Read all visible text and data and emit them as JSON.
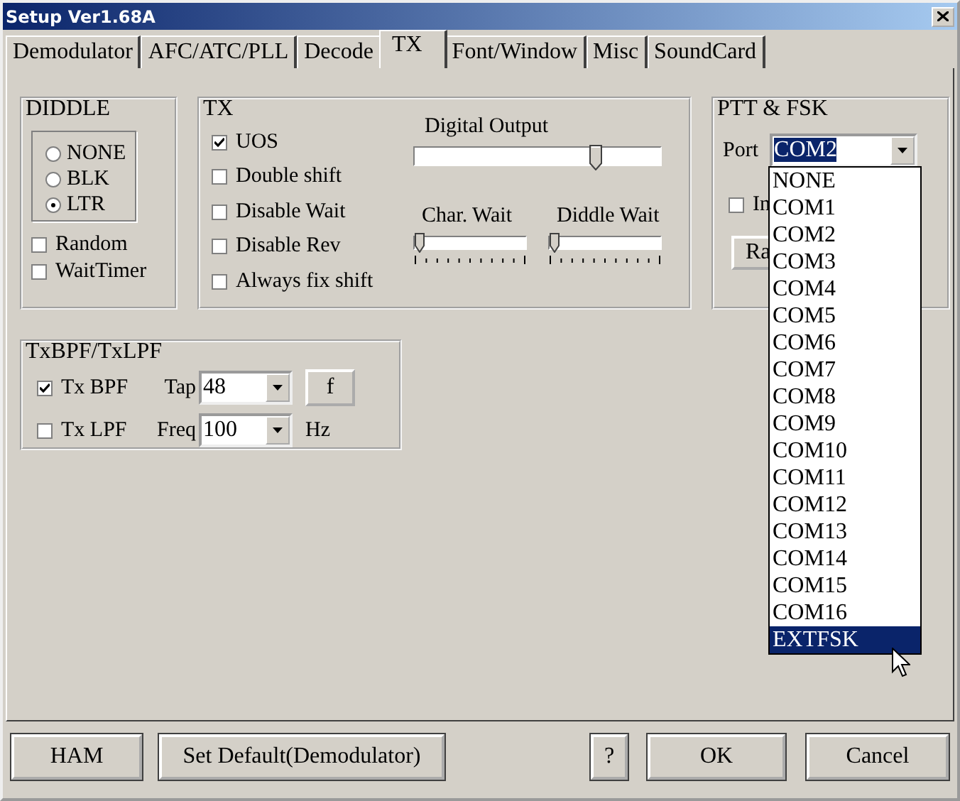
{
  "window": {
    "title": "Setup Ver1.68A"
  },
  "tabs": [
    {
      "label": "Demodulator",
      "selected": false
    },
    {
      "label": "AFC/ATC/PLL",
      "selected": false
    },
    {
      "label": "Decode",
      "selected": false
    },
    {
      "label": "TX",
      "selected": true
    },
    {
      "label": "Font/Window",
      "selected": false
    },
    {
      "label": "Misc",
      "selected": false
    },
    {
      "label": "SoundCard",
      "selected": false
    }
  ],
  "diddle": {
    "title": "DIDDLE",
    "options": [
      {
        "label": "NONE",
        "selected": false
      },
      {
        "label": "BLK",
        "selected": false
      },
      {
        "label": "LTR",
        "selected": true
      }
    ],
    "checkboxes": [
      {
        "label": "Random",
        "checked": false
      },
      {
        "label": "WaitTimer",
        "checked": false
      }
    ]
  },
  "tx": {
    "title": "TX",
    "checkboxes": [
      {
        "label": "UOS",
        "checked": true
      },
      {
        "label": "Double shift",
        "checked": false
      },
      {
        "label": "Disable Wait",
        "checked": false
      },
      {
        "label": "Disable Rev",
        "checked": false
      },
      {
        "label": "Always fix shift",
        "checked": false
      }
    ],
    "sliders": [
      {
        "label": "Digital Output",
        "kind": "plain",
        "level": 0.74
      },
      {
        "label": "Char. Wait",
        "kind": "ticked",
        "level": 0
      },
      {
        "label": "Diddle Wait",
        "kind": "ticked",
        "level": 0
      }
    ]
  },
  "ptt": {
    "title": "PTT & FSK",
    "port_label": "Port",
    "port_value": "COM2",
    "invert": {
      "label": "In",
      "checked": false
    },
    "button": "Ra",
    "options": [
      {
        "label": "NONE",
        "selected": false
      },
      {
        "label": "COM1",
        "selected": false
      },
      {
        "label": "COM2",
        "selected": false
      },
      {
        "label": "COM3",
        "selected": false
      },
      {
        "label": "COM4",
        "selected": false
      },
      {
        "label": "COM5",
        "selected": false
      },
      {
        "label": "COM6",
        "selected": false
      },
      {
        "label": "COM7",
        "selected": false
      },
      {
        "label": "COM8",
        "selected": false
      },
      {
        "label": "COM9",
        "selected": false
      },
      {
        "label": "COM10",
        "selected": false
      },
      {
        "label": "COM11",
        "selected": false
      },
      {
        "label": "COM12",
        "selected": false
      },
      {
        "label": "COM13",
        "selected": false
      },
      {
        "label": "COM14",
        "selected": false
      },
      {
        "label": "COM15",
        "selected": false
      },
      {
        "label": "COM16",
        "selected": false
      },
      {
        "label": "EXTFSK",
        "selected": true
      }
    ]
  },
  "filters": {
    "title": "TxBPF/TxLPF",
    "rows": [
      {
        "label": "Tx BPF",
        "checked": true,
        "field_label": "Tap",
        "value": "48",
        "extra": "f",
        "kind": "button"
      },
      {
        "label": "Tx LPF",
        "checked": false,
        "field_label": "Freq",
        "value": "100",
        "extra": "Hz",
        "kind": "unit"
      }
    ]
  },
  "buttons": [
    {
      "label": "HAM",
      "kind": "wide"
    },
    {
      "label": "Set Default(Demodulator)",
      "kind": "wide"
    },
    {
      "label": "?",
      "kind": "small"
    },
    {
      "label": "OK",
      "kind": "wide"
    },
    {
      "label": "Cancel",
      "kind": "wide"
    }
  ]
}
